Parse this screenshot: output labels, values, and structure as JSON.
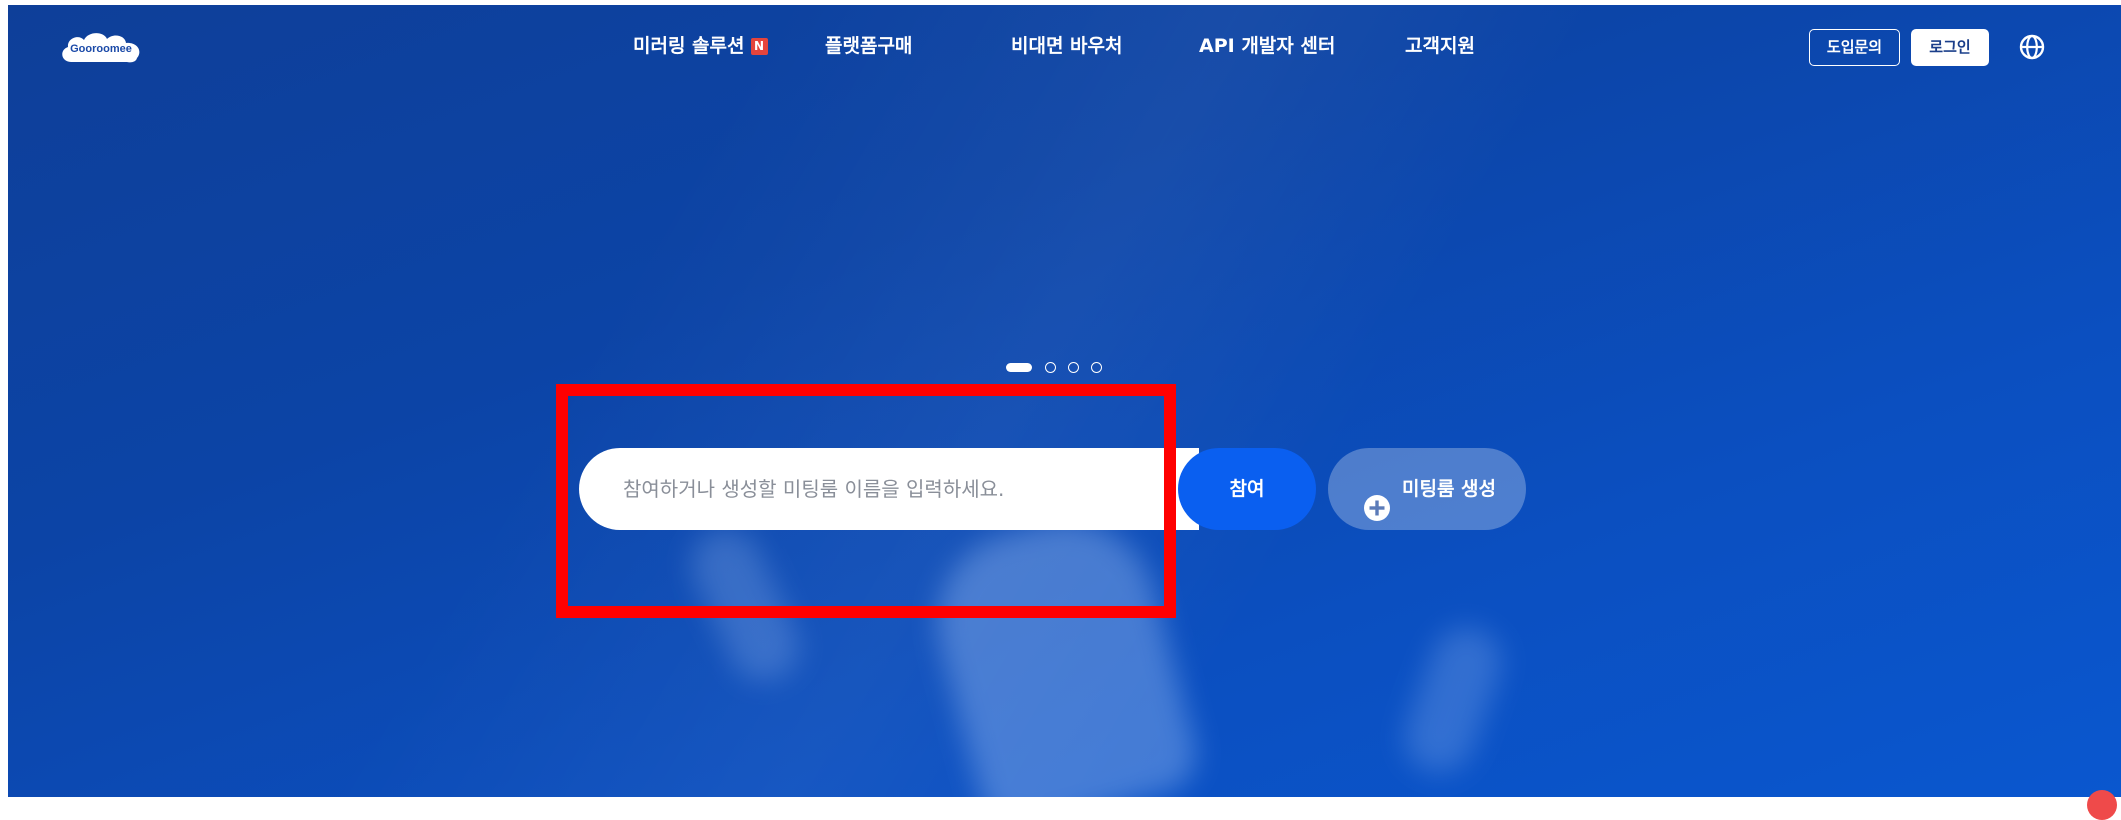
{
  "header": {
    "logo_text": "Gooroomee",
    "nav": [
      {
        "label": "미러링 솔루션",
        "badge": "N"
      },
      {
        "label": "플랫폼구매"
      },
      {
        "label": "비대면 바우처"
      },
      {
        "label": "API 개발자 센터"
      },
      {
        "label": "고객지원"
      }
    ],
    "inquiry_label": "도입문의",
    "login_label": "로그인",
    "language_icon": "globe-icon"
  },
  "slider": {
    "total": 4,
    "active_index": 0
  },
  "search": {
    "placeholder": "참여하거나 생성할 미팅룸 이름을 입력하세요.",
    "value": "",
    "join_label": "참여",
    "create_label": "미팅룸 생성",
    "create_icon": "plus-circle-icon"
  },
  "colors": {
    "background": "#0c44a6",
    "join_button": "#0a5ff0",
    "badge": "#e4443c",
    "highlight": "#ff0000"
  }
}
